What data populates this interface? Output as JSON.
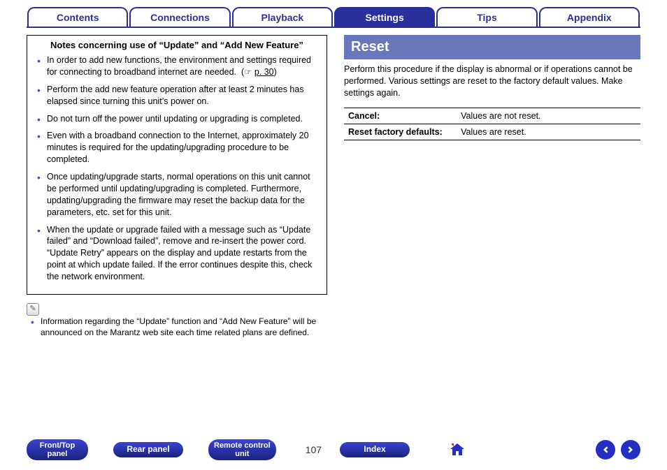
{
  "tabs": [
    {
      "label": "Contents",
      "active": false
    },
    {
      "label": "Connections",
      "active": false
    },
    {
      "label": "Playback",
      "active": false
    },
    {
      "label": "Settings",
      "active": true
    },
    {
      "label": "Tips",
      "active": false
    },
    {
      "label": "Appendix",
      "active": false
    }
  ],
  "notes": {
    "title": "Notes concerning use of “Update” and “Add New Feature”",
    "items": [
      "In order to add new functions, the environment and settings required for connecting to broadband internet are needed.  (☞ p. 30)",
      "Perform the add new feature operation after at least 2 minutes has elapsed since turning this unit’s power on.",
      "Do not turn off the power until updating or upgrading is completed.",
      "Even with a broadband connection to the Internet, approximately 20 minutes is required for the updating/upgrading procedure to be completed.",
      "Once updating/upgrade starts, normal operations on this unit cannot be performed until updating/upgrading is completed. Furthermore, updating/upgrading the firmware may reset the backup data for the parameters, etc. set for this unit.",
      "When the update or upgrade failed with a message such as “Update failed” and “Download failed”, remove and re-insert the power cord. “Update Retry” appears on the display and update restarts from the point at which update failed. If the error continues despite this, check the network environment."
    ],
    "footnote": "Information regarding the “Update” function and “Add New Feature” will be announced on the Marantz web site each time related plans are defined.",
    "link_text": "p. 30"
  },
  "reset": {
    "heading": "Reset",
    "description": "Perform this procedure if the display is abnormal or if operations cannot be performed. Various settings are reset to the factory default values. Make settings again.",
    "rows": [
      {
        "label": "Cancel:",
        "value": "Values are not reset."
      },
      {
        "label": "Reset factory defaults:",
        "value": "Values are reset."
      }
    ]
  },
  "footer": {
    "buttons": [
      "Front/Top panel",
      "Rear panel",
      "Remote control unit"
    ],
    "page": "107",
    "index": "Index"
  }
}
